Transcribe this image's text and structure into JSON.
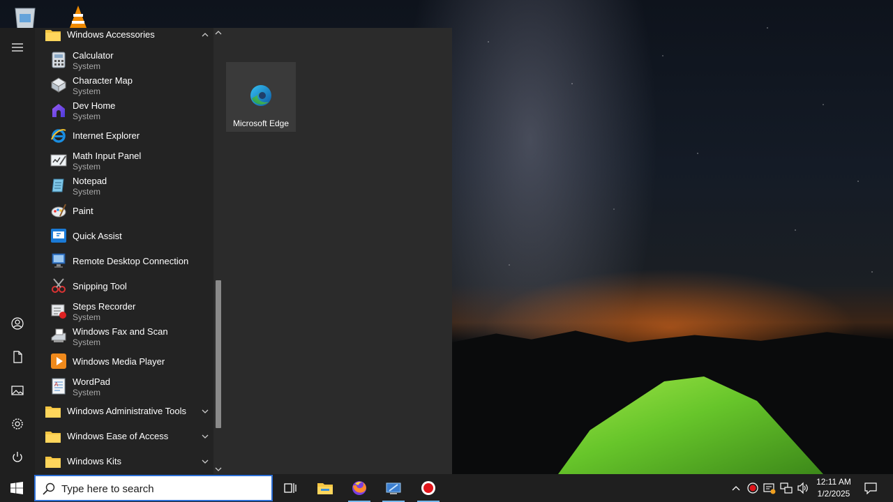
{
  "start_menu": {
    "folders": {
      "accessories": "Windows Accessories",
      "admin_tools": "Windows Administrative Tools",
      "ease_of_access": "Windows Ease of Access",
      "kits": "Windows Kits"
    },
    "apps": [
      {
        "name": "Calculator",
        "sub": "System"
      },
      {
        "name": "Character Map",
        "sub": "System"
      },
      {
        "name": "Dev Home",
        "sub": "System"
      },
      {
        "name": "Internet Explorer",
        "sub": ""
      },
      {
        "name": "Math Input Panel",
        "sub": "System"
      },
      {
        "name": "Notepad",
        "sub": "System"
      },
      {
        "name": "Paint",
        "sub": ""
      },
      {
        "name": "Quick Assist",
        "sub": ""
      },
      {
        "name": "Remote Desktop Connection",
        "sub": ""
      },
      {
        "name": "Snipping Tool",
        "sub": ""
      },
      {
        "name": "Steps Recorder",
        "sub": "System"
      },
      {
        "name": "Windows Fax and Scan",
        "sub": "System"
      },
      {
        "name": "Windows Media Player",
        "sub": ""
      },
      {
        "name": "WordPad",
        "sub": "System"
      }
    ],
    "tile": {
      "label": "Microsoft Edge"
    },
    "rail_icons": [
      "hamburger-icon",
      "user-icon",
      "documents-icon",
      "pictures-icon",
      "settings-icon",
      "power-icon"
    ]
  },
  "taskbar": {
    "search_placeholder": "Type here to search",
    "apps": [
      "task-view-icon",
      "file-explorer-icon",
      "firefox-icon",
      "remote-app-icon",
      "screen-recorder-icon"
    ],
    "clock": {
      "time": "12:11 AM",
      "date": "1/2/2025"
    }
  },
  "colors": {
    "menu_bg": "#2b2b2b",
    "list_bg": "#232323",
    "taskbar_bg": "#1f1f1f",
    "accent": "#2d6fd6"
  }
}
